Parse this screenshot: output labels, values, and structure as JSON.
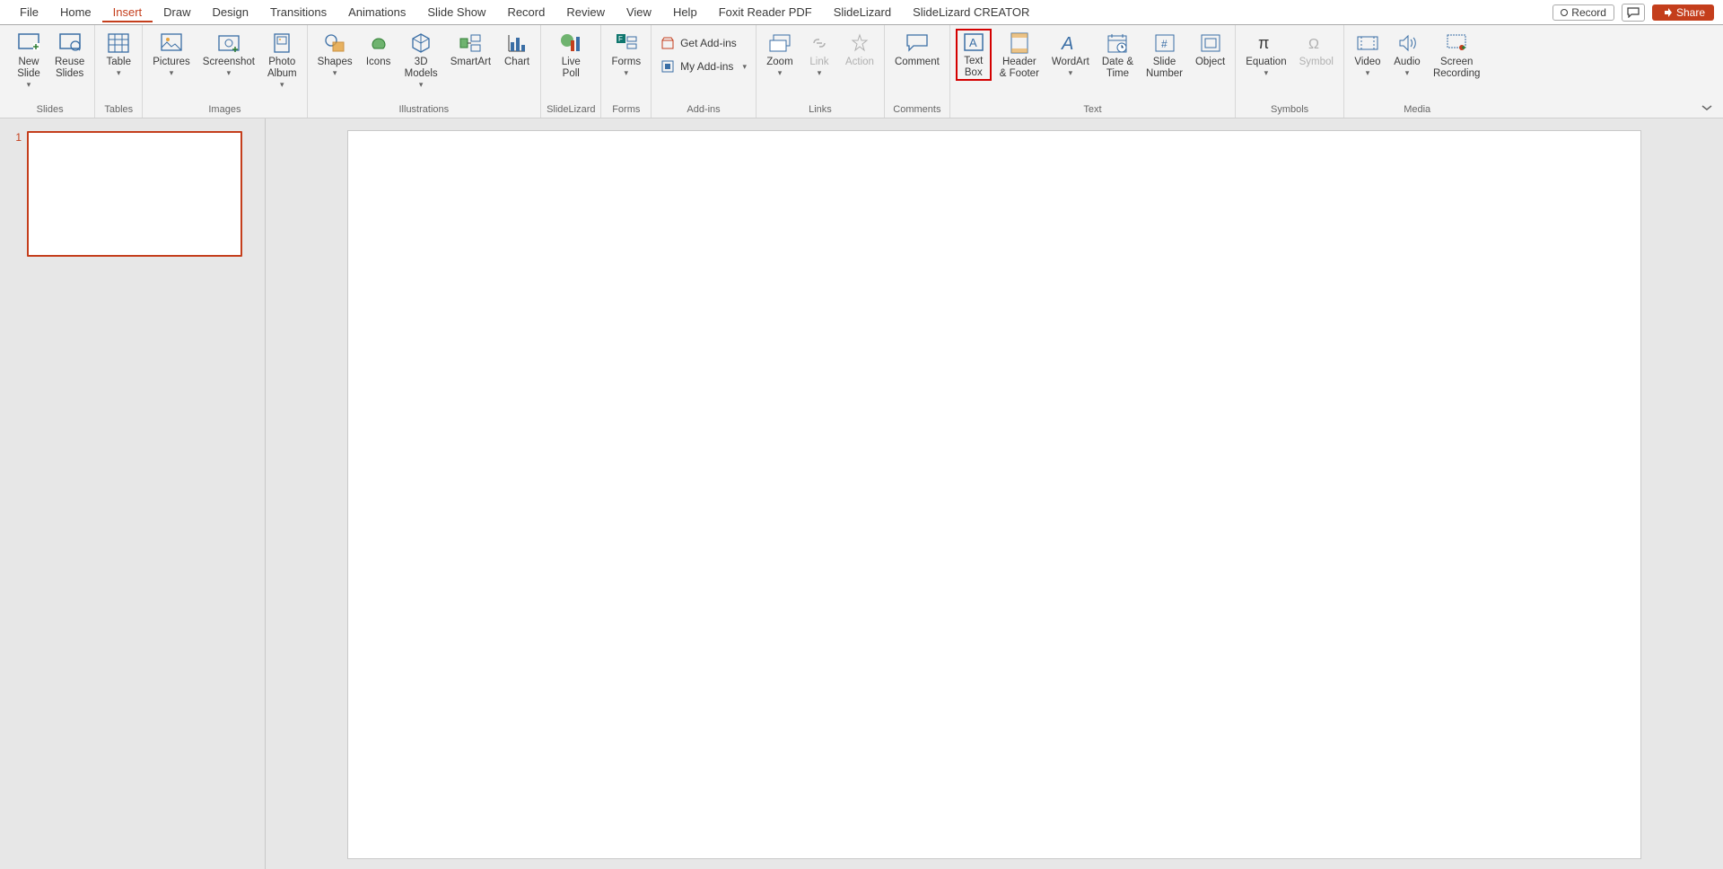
{
  "menu": {
    "tabs": [
      "File",
      "Home",
      "Insert",
      "Draw",
      "Design",
      "Transitions",
      "Animations",
      "Slide Show",
      "Record",
      "Review",
      "View",
      "Help",
      "Foxit Reader PDF",
      "SlideLizard",
      "SlideLizard CREATOR"
    ],
    "active_index": 2,
    "record": "Record",
    "share": "Share"
  },
  "ribbon": {
    "slides": {
      "title": "Slides",
      "new_slide": "New\nSlide",
      "reuse_slides": "Reuse\nSlides"
    },
    "tables": {
      "title": "Tables",
      "table": "Table"
    },
    "images": {
      "title": "Images",
      "pictures": "Pictures",
      "screenshot": "Screenshot",
      "photo_album": "Photo\nAlbum"
    },
    "illustrations": {
      "title": "Illustrations",
      "shapes": "Shapes",
      "icons": "Icons",
      "models": "3D\nModels",
      "smartart": "SmartArt",
      "chart": "Chart"
    },
    "slidelizard": {
      "title": "SlideLizard",
      "live_poll": "Live\nPoll"
    },
    "forms": {
      "title": "Forms",
      "forms": "Forms"
    },
    "addins": {
      "title": "Add-ins",
      "get": "Get Add-ins",
      "my": "My Add-ins"
    },
    "links": {
      "title": "Links",
      "zoom": "Zoom",
      "link": "Link",
      "action": "Action"
    },
    "comments": {
      "title": "Comments",
      "comment": "Comment"
    },
    "text": {
      "title": "Text",
      "text_box": "Text\nBox",
      "header_footer": "Header\n& Footer",
      "wordart": "WordArt",
      "date_time": "Date &\nTime",
      "slide_number": "Slide\nNumber",
      "object": "Object"
    },
    "symbols": {
      "title": "Symbols",
      "equation": "Equation",
      "symbol": "Symbol"
    },
    "media": {
      "title": "Media",
      "video": "Video",
      "audio": "Audio",
      "screen_recording": "Screen\nRecording"
    }
  },
  "thumbs": {
    "items": [
      {
        "num": "1"
      }
    ]
  }
}
